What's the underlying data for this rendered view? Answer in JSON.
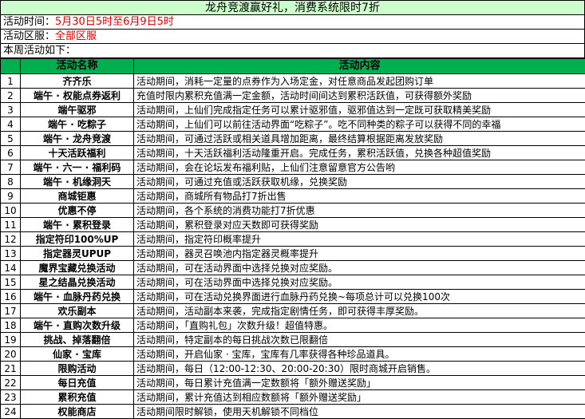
{
  "title": "龙舟竞渡赢好礼，消费系统限时7折",
  "info": {
    "time_label": "活动时间：",
    "time_value": "5月30日5时至6月9日5时",
    "server_label": "活动区服：",
    "server_value": "全部区服",
    "weekly_label": "本周活动如下："
  },
  "table": {
    "headers": [
      "",
      "活动名称",
      "活动内容"
    ],
    "rows": [
      {
        "no": "1",
        "name": "齐齐乐",
        "desc": "活动期间，消耗一定量的点券作为入场定金，对任意商品发起团购订单"
      },
      {
        "no": "2",
        "name": "端午 · 权能点券返利",
        "desc": "充值时限内累积充值满一定金额，活动时间间达到累积活跃值，可获得额外奖励"
      },
      {
        "no": "3",
        "name": "端午驱邪",
        "desc": "活动期间，上仙们完成指定任务可以累计驱邪值，驱邪值达到一定既可获取精美奖励"
      },
      {
        "no": "4",
        "name": "端午 · 吃粽子",
        "desc": "活动期间，上仙们可以前往活动界面“吃粽子”。吃不同种类的粽子可以获得不同的幸福"
      },
      {
        "no": "5",
        "name": "端午 · 龙舟竞渡",
        "desc": "活动期间，可通过活跃或相关道具增加距离，最终结算根据距离发放奖励"
      },
      {
        "no": "6",
        "name": "十天活跃福利",
        "desc": "活动期间，十天活跃福利活动隆重开启。完成任务，累积活跃值，兑换各种超值奖励"
      },
      {
        "no": "7",
        "name": "端午 · 六一 · 福利码",
        "desc": "活动期间，会在论坛发布福利贴，上仙们注意留意官方公告哟"
      },
      {
        "no": "8",
        "name": "端午 · 机缘洞天",
        "desc": "活动期间，可通过充值或活跃获取机缘，兑换奖励"
      },
      {
        "no": "9",
        "name": "商城钜惠",
        "desc": "活动期间，商城所有物品打7折出售"
      },
      {
        "no": "10",
        "name": "优惠不停",
        "desc": "活动期间，各个系统的消费功能打7折优惠"
      },
      {
        "no": "11",
        "name": "端午 · 累积登录",
        "desc": "活动期间，累积登录对应天数即可获得奖励"
      },
      {
        "no": "12",
        "name": "指定符印100%UP",
        "desc": "活动期间，指定符印概率提升"
      },
      {
        "no": "13",
        "name": "指定器灵UPUP",
        "desc": "活动期间，器灵召唤池内指定器灵概率提升"
      },
      {
        "no": "14",
        "name": "魔界宝藏兑换活动",
        "desc": "活动期间，可在活动界面中选择兑换对应奖励。"
      },
      {
        "no": "15",
        "name": "星之结晶兑换活动",
        "desc": "活动期间，可在活动界面中选择兑换对应奖励。"
      },
      {
        "no": "16",
        "name": "端午 · 血脉丹药兑换",
        "desc": "活动期间，可在活动兑换界面进行血脉丹药兑换~每项总计可以兑换100次"
      },
      {
        "no": "17",
        "name": "欢乐副本",
        "desc": "活动期间，活动副本来袭，完成指定剧情任务，即可获得丰厚奖励。"
      },
      {
        "no": "18",
        "name": "端午 · 直购次数升级",
        "desc": "活动期间，「直购礼包」次数升级！超值特惠。"
      },
      {
        "no": "19",
        "name": "挑战、掉落翻倍",
        "desc": "活动期间，特定副本的每日挑战次数已限翻倍"
      },
      {
        "no": "20",
        "name": "仙家 · 宝库",
        "desc": "活动期间，开启仙家 · 宝库，宝库有几率获得各种珍品道具。"
      },
      {
        "no": "21",
        "name": "限购活动",
        "desc": "活动期间，每日（12:00-12:30、20:00-20:30）限时商城开启销售。"
      },
      {
        "no": "22",
        "name": "每日充值",
        "desc": "活动期间，每日累计充值满一定数额将「额外赠送奖励」"
      },
      {
        "no": "23",
        "name": "累积充值",
        "desc": "活动期间，累计充值达到相应数额将「额外赠送奖励」"
      },
      {
        "no": "24",
        "name": "权能商店",
        "desc": "活动期间限时解锁，使用天机解锁不同档位"
      }
    ]
  }
}
